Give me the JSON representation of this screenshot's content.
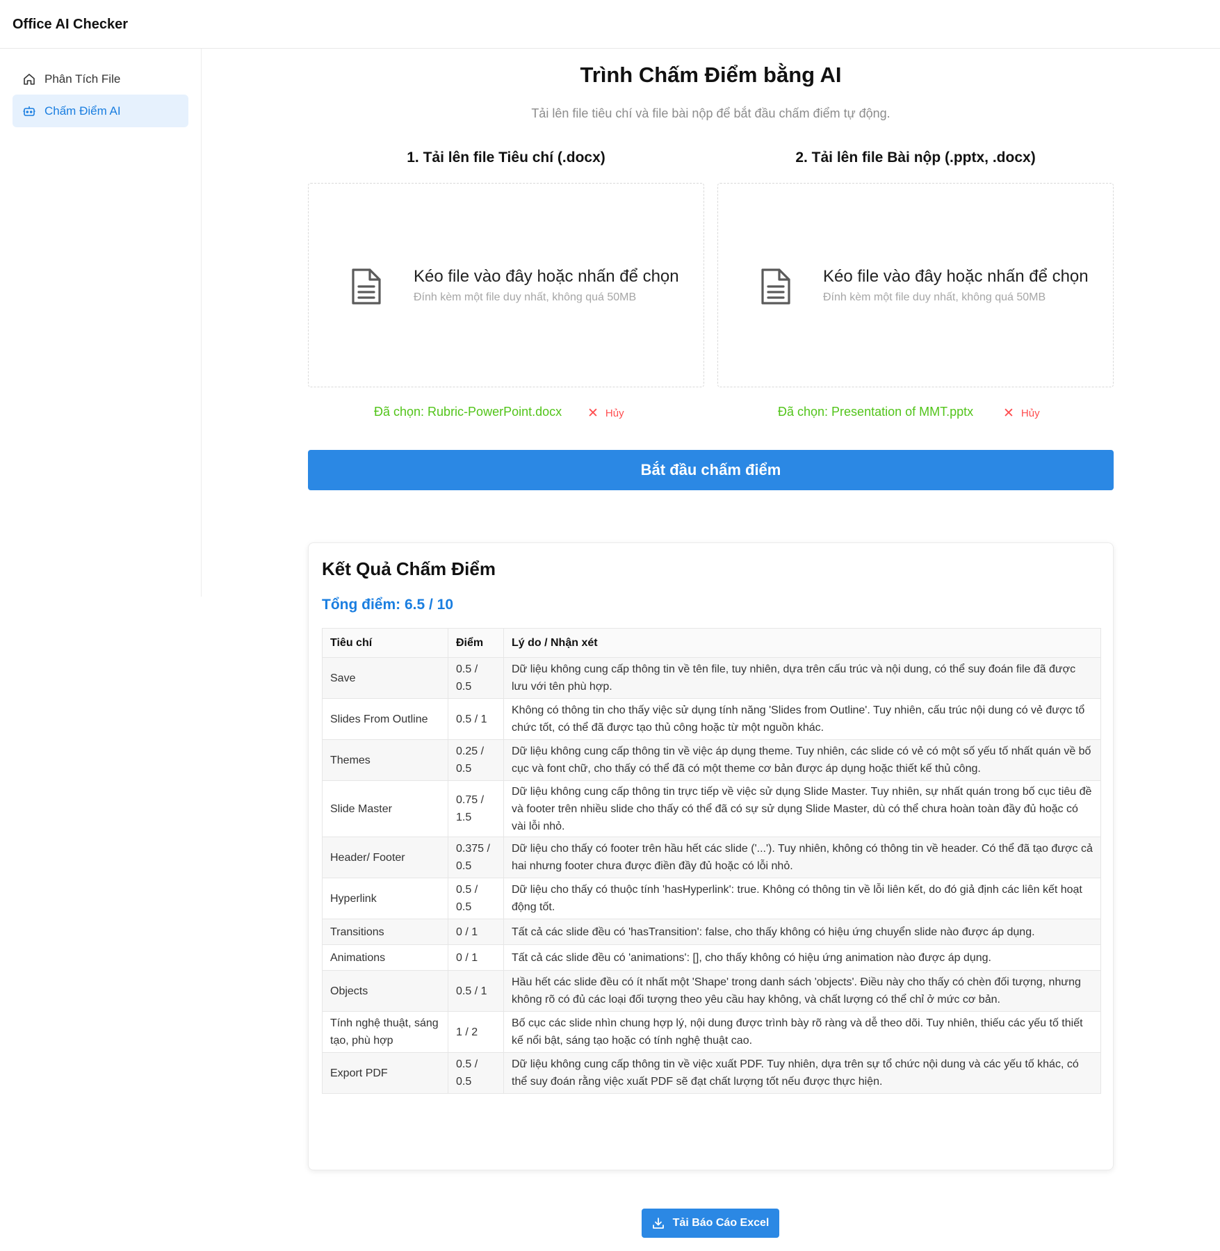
{
  "app": {
    "title": "Office AI Checker"
  },
  "sidebar": {
    "items": [
      {
        "label": "Phân Tích File",
        "icon": "home-icon",
        "active": false
      },
      {
        "label": "Chấm Điểm AI",
        "icon": "robot-icon",
        "active": true
      }
    ]
  },
  "page": {
    "title": "Trình Chấm Điểm bằng AI",
    "subtitle": "Tải lên file tiêu chí và file bài nộp để bắt đầu chấm điểm tự động."
  },
  "uploads": [
    {
      "heading": "1. Tải lên file Tiêu chí (.docx)",
      "drop_text": "Kéo file vào đây hoặc nhấn để chọn",
      "drop_hint": "Đính kèm một file duy nhất, không quá 50MB",
      "selected": "Đã chọn: Rubric-PowerPoint.docx",
      "cancel_label": "Hủy"
    },
    {
      "heading": "2. Tải lên file Bài nộp (.pptx, .docx)",
      "drop_text": "Kéo file vào đây hoặc nhấn để chọn",
      "drop_hint": "Đính kèm một file duy nhất, không quá 50MB",
      "selected": "Đã chọn: Presentation of MMT.pptx",
      "cancel_label": "Hủy"
    }
  ],
  "start_button": "Bắt đầu chấm điểm",
  "results": {
    "title": "Kết Quả Chấm Điểm",
    "total": "Tổng điểm: 6.5 / 10",
    "headers": [
      "Tiêu chí",
      "Điểm",
      "Lý do / Nhận xét"
    ],
    "rows": [
      {
        "criterion": "Save",
        "score": "0.5 / 0.5",
        "comment": "Dữ liệu không cung cấp thông tin về tên file, tuy nhiên, dựa trên cấu trúc và nội dung, có thể suy đoán file đã được lưu với tên phù hợp."
      },
      {
        "criterion": "Slides From Outline",
        "score": "0.5 / 1",
        "comment": "Không có thông tin cho thấy việc sử dụng tính năng 'Slides from Outline'. Tuy nhiên, cấu trúc nội dung có vẻ được tổ chức tốt, có thể đã được tạo thủ công hoặc từ một nguồn khác."
      },
      {
        "criterion": "Themes",
        "score": "0.25 / 0.5",
        "comment": "Dữ liệu không cung cấp thông tin về việc áp dụng theme. Tuy nhiên, các slide có vẻ có một số yếu tố nhất quán về bố cục và font chữ, cho thấy có thể đã có một theme cơ bản được áp dụng hoặc thiết kế thủ công."
      },
      {
        "criterion": "Slide Master",
        "score": "0.75 / 1.5",
        "comment": "Dữ liệu không cung cấp thông tin trực tiếp về việc sử dụng Slide Master. Tuy nhiên, sự nhất quán trong bố cục tiêu đề và footer trên nhiều slide cho thấy có thể đã có sự sử dụng Slide Master, dù có thể chưa hoàn toàn đầy đủ hoặc có vài lỗi nhỏ."
      },
      {
        "criterion": "Header/ Footer",
        "score": "0.375 / 0.5",
        "comment": "Dữ liệu cho thấy có footer trên hầu hết các slide ('...'). Tuy nhiên, không có thông tin về header. Có thể đã tạo được cả hai nhưng footer chưa được điền đầy đủ hoặc có lỗi nhỏ."
      },
      {
        "criterion": "Hyperlink",
        "score": "0.5 / 0.5",
        "comment": "Dữ liệu cho thấy có thuộc tính 'hasHyperlink': true. Không có thông tin về lỗi liên kết, do đó giả định các liên kết hoạt động tốt."
      },
      {
        "criterion": "Transitions",
        "score": "0 / 1",
        "comment": "Tất cả các slide đều có 'hasTransition': false, cho thấy không có hiệu ứng chuyển slide nào được áp dụng."
      },
      {
        "criterion": "Animations",
        "score": "0 / 1",
        "comment": "Tất cả các slide đều có 'animations': [], cho thấy không có hiệu ứng animation nào được áp dụng."
      },
      {
        "criterion": "Objects",
        "score": "0.5 / 1",
        "comment": "Hầu hết các slide đều có ít nhất một 'Shape' trong danh sách 'objects'. Điều này cho thấy có chèn đối tượng, nhưng không rõ có đủ các loại đối tượng theo yêu cầu hay không, và chất lượng có thể chỉ ở mức cơ bản."
      },
      {
        "criterion": "Tính nghệ thuật, sáng tạo, phù hợp",
        "score": "1 / 2",
        "comment": "Bố cục các slide nhìn chung hợp lý, nội dung được trình bày rõ ràng và dễ theo dõi. Tuy nhiên, thiếu các yếu tố thiết kế nổi bật, sáng tạo hoặc có tính nghệ thuật cao."
      },
      {
        "criterion": "Export PDF",
        "score": "0.5 / 0.5",
        "comment": "Dữ liệu không cung cấp thông tin về việc xuất PDF. Tuy nhiên, dựa trên sự tổ chức nội dung và các yếu tố khác, có thể suy đoán rằng việc xuất PDF sẽ đạt chất lượng tốt nếu được thực hiện."
      }
    ]
  },
  "excel_button": "Tải Báo Cáo Excel",
  "colors": {
    "primary": "#2b88e4",
    "success": "#52c41a",
    "danger": "#ff4d4f",
    "active_bg": "#e6f1fd"
  }
}
